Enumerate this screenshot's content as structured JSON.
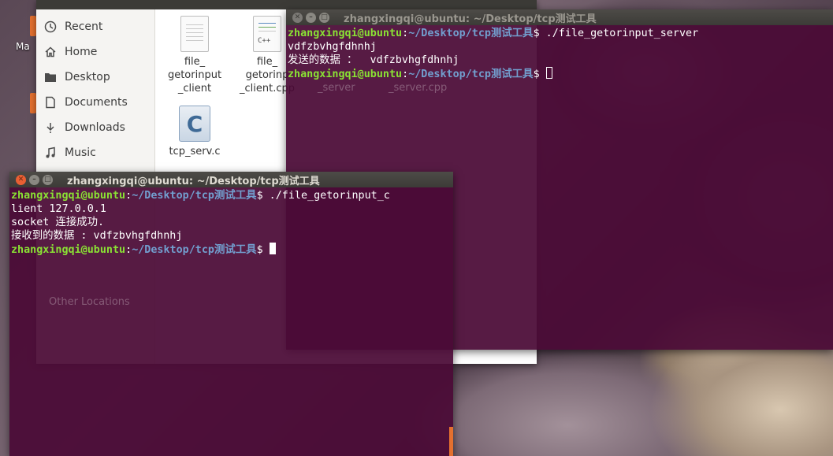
{
  "desktop": {
    "icon_label": "Ma"
  },
  "file_manager": {
    "sidebar": [
      {
        "label": "Recent",
        "icon": "clock-icon"
      },
      {
        "label": "Home",
        "icon": "home-icon"
      },
      {
        "label": "Desktop",
        "icon": "folder-icon"
      },
      {
        "label": "Documents",
        "icon": "document-icon"
      },
      {
        "label": "Downloads",
        "icon": "download-icon"
      },
      {
        "label": "Music",
        "icon": "music-icon"
      }
    ],
    "files": [
      {
        "name": "file_\ngetorinput\n_client",
        "icon": "text-file-icon"
      },
      {
        "name": "file_\ngetorinp\n_client.cpp",
        "icon": "cpp-file-icon",
        "tag": "C++"
      },
      {
        "name": "tcp_serv.c",
        "icon": "c-file-icon",
        "glyph": "C"
      }
    ],
    "ghost_labels": [
      "Other Locations",
      "_server",
      "_server.cpp"
    ]
  },
  "server_terminal": {
    "title": "zhangxingqi@ubuntu: ~/Desktop/tcp测试工具",
    "lines": [
      {
        "user": "zhangxingqi@ubuntu",
        "sep": ":",
        "path": "~/Desktop/tcp测试工具",
        "cmd": "$ ./file_getorinput_server"
      },
      {
        "text": "vdfzbvhgfdhnhj"
      },
      {
        "text": "发送的数据 ：  vdfzbvhgfdhnhj"
      },
      {
        "user": "zhangxingqi@ubuntu",
        "sep": ":",
        "path": "~/Desktop/tcp测试工具",
        "cmd": "$ "
      }
    ]
  },
  "client_terminal": {
    "title": "zhangxingqi@ubuntu: ~/Desktop/tcp测试工具",
    "lines": [
      {
        "user": "zhangxingqi@ubuntu",
        "sep": ":",
        "path": "~/Desktop/tcp测试工具",
        "cmd": "$ ./file_getorinput_c"
      },
      {
        "text": "lient 127.0.0.1"
      },
      {
        "text": "socket 连接成功."
      },
      {
        "text": "接收到的数据 : vdfzbvhgfdhnhj"
      },
      {
        "user": "zhangxingqi@ubuntu",
        "sep": ":",
        "path": "~/Desktop/tcp测试工具",
        "cmd": "$ "
      }
    ]
  },
  "colors": {
    "terminal_bg": "#4a0a36",
    "prompt_user": "#8ae234",
    "prompt_path": "#729fcf",
    "close_button": "#e95f33"
  }
}
